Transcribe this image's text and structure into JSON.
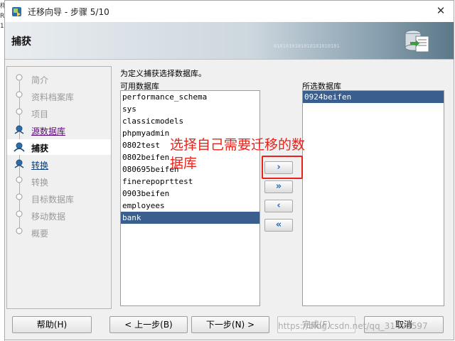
{
  "edge_fragment": [
    "样",
    "RO",
    "10"
  ],
  "window": {
    "title": "迁移向导 - 步骤 5/10"
  },
  "banner": {
    "title": "捕获",
    "bits": "0101010101010101010101"
  },
  "nav": {
    "items": [
      {
        "label": "简介",
        "state": "disabled"
      },
      {
        "label": "资料档案库",
        "state": "disabled"
      },
      {
        "label": "项目",
        "state": "disabled"
      },
      {
        "label": "源数据库",
        "state": "visited"
      },
      {
        "label": "捕获",
        "state": "current"
      },
      {
        "label": "转换",
        "state": "link"
      },
      {
        "label": "转换",
        "state": "disabled"
      },
      {
        "label": "目标数据库",
        "state": "disabled"
      },
      {
        "label": "移动数据",
        "state": "disabled"
      },
      {
        "label": "概要",
        "state": "disabled"
      }
    ]
  },
  "main": {
    "description": "为定义捕获选择数据库。",
    "available_label": "可用数据库",
    "selected_label": "所选数据库",
    "available": [
      "performance_schema",
      "sys",
      "classicmodels",
      "phpmyadmin",
      "0802test",
      "0802beifen",
      "080695beifen",
      "finerepoprttest",
      "0903beifen",
      "employees",
      "bank"
    ],
    "available_selected_index": 10,
    "selected": [
      "0924beifen"
    ],
    "selected_selected_index": 0
  },
  "move_buttons": {
    "add": "›",
    "add_all": "»",
    "remove": "‹",
    "remove_all": "«"
  },
  "annotation": "选择自己需要迁移的数据库",
  "footer": {
    "help": "帮助(H)",
    "back": "< 上一步(B)",
    "next": "下一步(N) >",
    "finish": "完成(F)",
    "cancel": "取消"
  },
  "watermark": "https://blog.csdn.net/qq_31492597",
  "colors": {
    "accent": "#3a5f8f",
    "annotation": "#e8231b",
    "link": "#0a3a7a"
  }
}
